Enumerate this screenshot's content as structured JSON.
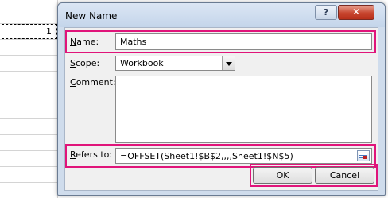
{
  "sheet": {
    "cell_value": "1"
  },
  "dialog": {
    "title": "New Name",
    "help_glyph": "?",
    "close_glyph": "✕",
    "name": {
      "label_accel": "N",
      "label_rest": "ame:",
      "value": "Maths"
    },
    "scope": {
      "label_accel": "S",
      "label_rest": "cope:",
      "value": "Workbook"
    },
    "comment": {
      "label_accel": "C",
      "label_rest": "omment:",
      "value": ""
    },
    "refers_to": {
      "label_accel": "R",
      "label_rest": "efers to:",
      "value": "=OFFSET(Sheet1!$B$2,,,,Sheet1!$N$5)"
    },
    "ok_label": "OK",
    "cancel_label": "Cancel"
  },
  "colors": {
    "highlight": "#e0147a",
    "dialog_frame": "#cfdcec",
    "close_button": "#c7452e"
  }
}
